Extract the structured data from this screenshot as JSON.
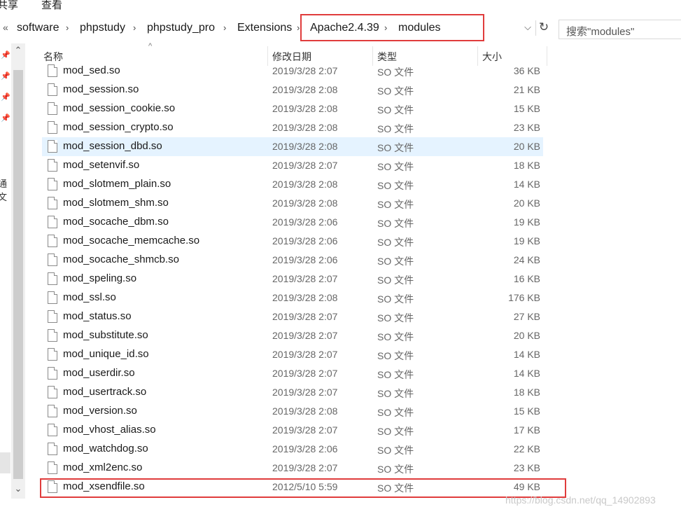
{
  "ribbon": {
    "tabs": [
      "共享",
      "查看"
    ]
  },
  "address": {
    "overflow": "«",
    "crumbs": [
      "software",
      "phpstudy",
      "phpstudy_pro",
      "Extensions",
      "Apache2.4.39",
      "modules"
    ],
    "dropdown": "⌵",
    "refresh": "↻"
  },
  "search": {
    "placeholder": "搜索\"modules\""
  },
  "nav": {
    "partial_label": "通文"
  },
  "columns": {
    "name": "名称",
    "date": "修改日期",
    "type": "类型",
    "size": "大小"
  },
  "files": [
    {
      "name": "mod_sed.so",
      "date": "2019/3/28 2:07",
      "type": "SO 文件",
      "size": "36 KB"
    },
    {
      "name": "mod_session.so",
      "date": "2019/3/28 2:08",
      "type": "SO 文件",
      "size": "21 KB"
    },
    {
      "name": "mod_session_cookie.so",
      "date": "2019/3/28 2:08",
      "type": "SO 文件",
      "size": "15 KB"
    },
    {
      "name": "mod_session_crypto.so",
      "date": "2019/3/28 2:08",
      "type": "SO 文件",
      "size": "23 KB"
    },
    {
      "name": "mod_session_dbd.so",
      "date": "2019/3/28 2:08",
      "type": "SO 文件",
      "size": "20 KB",
      "selected": true
    },
    {
      "name": "mod_setenvif.so",
      "date": "2019/3/28 2:07",
      "type": "SO 文件",
      "size": "18 KB"
    },
    {
      "name": "mod_slotmem_plain.so",
      "date": "2019/3/28 2:08",
      "type": "SO 文件",
      "size": "14 KB"
    },
    {
      "name": "mod_slotmem_shm.so",
      "date": "2019/3/28 2:08",
      "type": "SO 文件",
      "size": "20 KB"
    },
    {
      "name": "mod_socache_dbm.so",
      "date": "2019/3/28 2:06",
      "type": "SO 文件",
      "size": "19 KB"
    },
    {
      "name": "mod_socache_memcache.so",
      "date": "2019/3/28 2:06",
      "type": "SO 文件",
      "size": "19 KB"
    },
    {
      "name": "mod_socache_shmcb.so",
      "date": "2019/3/28 2:06",
      "type": "SO 文件",
      "size": "24 KB"
    },
    {
      "name": "mod_speling.so",
      "date": "2019/3/28 2:07",
      "type": "SO 文件",
      "size": "16 KB"
    },
    {
      "name": "mod_ssl.so",
      "date": "2019/3/28 2:08",
      "type": "SO 文件",
      "size": "176 KB"
    },
    {
      "name": "mod_status.so",
      "date": "2019/3/28 2:07",
      "type": "SO 文件",
      "size": "27 KB"
    },
    {
      "name": "mod_substitute.so",
      "date": "2019/3/28 2:07",
      "type": "SO 文件",
      "size": "20 KB"
    },
    {
      "name": "mod_unique_id.so",
      "date": "2019/3/28 2:07",
      "type": "SO 文件",
      "size": "14 KB"
    },
    {
      "name": "mod_userdir.so",
      "date": "2019/3/28 2:07",
      "type": "SO 文件",
      "size": "14 KB"
    },
    {
      "name": "mod_usertrack.so",
      "date": "2019/3/28 2:07",
      "type": "SO 文件",
      "size": "18 KB"
    },
    {
      "name": "mod_version.so",
      "date": "2019/3/28 2:08",
      "type": "SO 文件",
      "size": "15 KB"
    },
    {
      "name": "mod_vhost_alias.so",
      "date": "2019/3/28 2:07",
      "type": "SO 文件",
      "size": "17 KB"
    },
    {
      "name": "mod_watchdog.so",
      "date": "2019/3/28 2:06",
      "type": "SO 文件",
      "size": "22 KB"
    },
    {
      "name": "mod_xml2enc.so",
      "date": "2019/3/28 2:07",
      "type": "SO 文件",
      "size": "23 KB"
    },
    {
      "name": "mod_xsendfile.so",
      "date": "2012/5/10 5:59",
      "type": "SO 文件",
      "size": "49 KB"
    }
  ],
  "watermark": "https://blog.csdn.net/qq_14902893",
  "colors": {
    "highlight_box": "#e03c3c",
    "selected_row": "#e5f3ff"
  }
}
